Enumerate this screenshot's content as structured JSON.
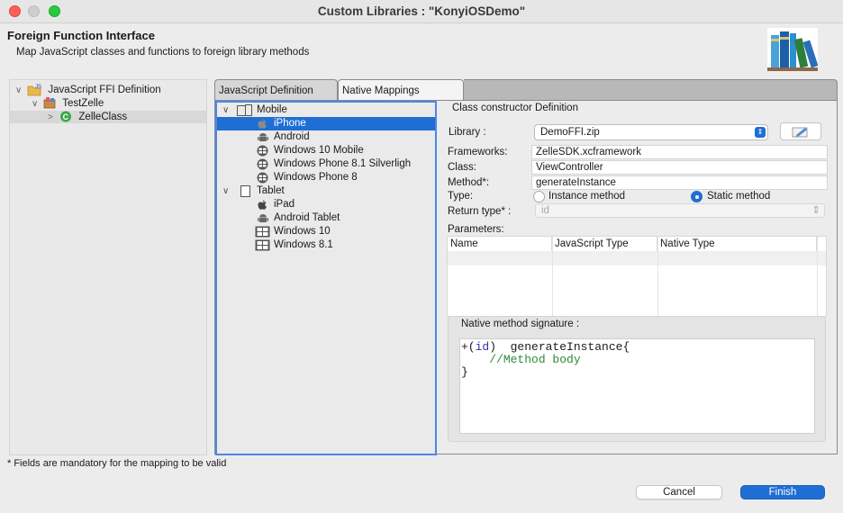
{
  "window": {
    "title": "Custom Libraries : \"KonyiOSDemo\""
  },
  "header": {
    "title": "Foreign Function Interface",
    "description": "Map JavaScript classes and functions to foreign library methods"
  },
  "left_tree": {
    "items": [
      {
        "label": "JavaScript FFI Definition",
        "icon": "js-ffi-icon",
        "expanded": true
      },
      {
        "label": "TestZelle",
        "icon": "library-package-icon",
        "expanded": true
      },
      {
        "label": "ZelleClass",
        "icon": "class-c-icon",
        "expanded": false,
        "selected": true
      }
    ]
  },
  "tabs": [
    {
      "label": "JavaScript Definition",
      "active": false
    },
    {
      "label": "Native Mappings",
      "active": true
    }
  ],
  "platforms": {
    "groups": [
      {
        "label": "Mobile",
        "icon": "mobile-devices-icon",
        "items": [
          {
            "label": "iPhone",
            "icon": "apple-icon",
            "selected": true
          },
          {
            "label": "Android",
            "icon": "android-icon"
          },
          {
            "label": "Windows 10 Mobile",
            "icon": "windows-phone-icon"
          },
          {
            "label": "Windows Phone 8.1 Silverligh",
            "icon": "windows-phone-icon"
          },
          {
            "label": "Windows Phone 8",
            "icon": "windows-phone-icon"
          }
        ]
      },
      {
        "label": "Tablet",
        "icon": "tablet-icon",
        "items": [
          {
            "label": "iPad",
            "icon": "apple-icon"
          },
          {
            "label": "Android Tablet",
            "icon": "android-icon"
          },
          {
            "label": "Windows 10",
            "icon": "windows-logo-icon"
          },
          {
            "label": "Windows 8.1",
            "icon": "windows-logo-icon"
          }
        ]
      }
    ]
  },
  "class_constructor": {
    "section_title": "Class constructor Definition",
    "library_label": "Library :",
    "library_value": "DemoFFI.zip",
    "frameworks_label": "Frameworks:",
    "frameworks_value": "ZelleSDK.xcframework",
    "class_label": "Class:",
    "class_value": "ViewController",
    "method_label": "Method*:",
    "method_value": "generateInstance",
    "type_label": "Type:",
    "type_options": [
      {
        "label": "Instance method",
        "selected": false
      },
      {
        "label": "Static method",
        "selected": true
      }
    ],
    "return_type_label": "Return type* :",
    "return_type_value": "id",
    "parameters_label": "Parameters:",
    "param_columns": [
      "Name",
      "JavaScript Type",
      "Native Type"
    ],
    "param_rows": []
  },
  "signature": {
    "title": "Native method signature :",
    "line1_prefix": "+(",
    "line1_type": "id",
    "line1_rest": ")  generateInstance{",
    "line2": "//Method body",
    "line3": "}"
  },
  "footnote": "* Fields are mandatory for the mapping to be valid",
  "buttons": {
    "cancel": "Cancel",
    "finish": "Finish"
  },
  "colors": {
    "accent": "#1f6ed4",
    "selection_border": "#4f86e6",
    "code_keyword": "#2a36a8",
    "code_comment": "#2e8b3a"
  }
}
